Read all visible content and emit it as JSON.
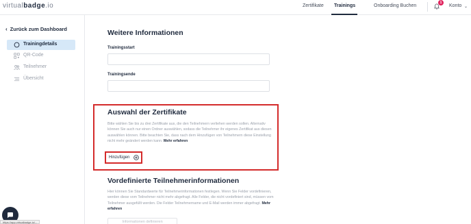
{
  "header": {
    "logo_prefix": "virtual",
    "logo_bold": "badge",
    "logo_suffix": ".io",
    "nav": [
      "Zertifikate",
      "Trainings",
      "Onboarding Buchen"
    ],
    "active_nav": "Trainings",
    "notification_count": "1",
    "account_label": "Konto"
  },
  "sidebar": {
    "back_label": "Zurück zum Dashboard",
    "items": [
      {
        "label": "Trainingdetails",
        "icon": "circle-icon",
        "active": true
      },
      {
        "label": "QR-Code",
        "icon": "qr-code-icon",
        "active": false
      },
      {
        "label": "Teilnehmer",
        "icon": "users-icon",
        "active": false
      },
      {
        "label": "Übersicht",
        "icon": "list-icon",
        "active": false
      }
    ]
  },
  "main": {
    "further_info": {
      "title": "Weitere Informationen",
      "start_label": "Trainingsstart",
      "start_value": "",
      "end_label": "Trainingsende",
      "end_value": ""
    },
    "certificates": {
      "title": "Auswahl der Zertifikate",
      "description": "Bitte wählen Sie bis zu drei Zertifikate aus, die den Teilnehmern verliehen werden sollen. Alternativ können Sie auch nur einen Ordner auswählen, sodass die Teilnehmer ihr eigenes Zertifikat aus diesen auswählen können. Bitte beachten Sie, dass nach dem Hinzufügen von Teilnehmern diese Einstellung nicht mehr geändert werden kann.",
      "learn_more": "Mehr erfahren",
      "add_button": "Hinzufügen"
    },
    "predefined": {
      "title": "Vordefinierte Teilnehmerinformationen",
      "description": "Hier können Sie Standardwerte für Teilnehmerinformationen festlegen. Wenn Sie Felder vordefinieren, werden diese vom Teilnehmer nicht mehr abgefragt. Alle Felder, die nicht vordefiniert sind, müssen vom Teilnehmer ausgefüllt werden. Die Felder Teilnehmername und E-Mail werden immer abgefragt.",
      "learn_more": "Mehr erfahren",
      "define_button": "Informationen definieren"
    }
  },
  "status_bar_url": "https://app.virtualbadge.io/...",
  "colors": {
    "accent": "#1f2a3d",
    "active_bg": "#d6e8f8",
    "highlight": "#d42a2a",
    "badge": "#e0245e"
  }
}
